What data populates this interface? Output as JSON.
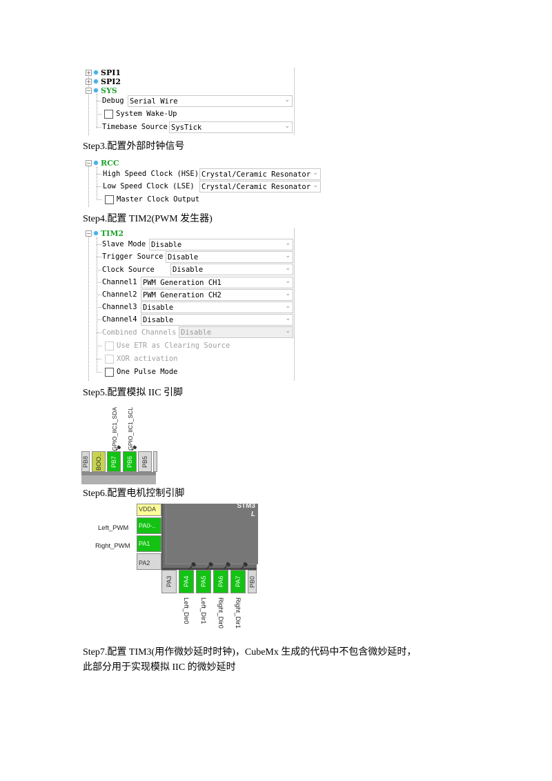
{
  "section_sys": {
    "tree": {
      "nodes": [
        {
          "label": "SPI1",
          "expander": "+",
          "active": false
        },
        {
          "label": "SPI2",
          "expander": "+",
          "active": false
        },
        {
          "label": "SYS",
          "expander": "-",
          "active": true
        }
      ],
      "debug_label": "Debug",
      "debug_value": "Serial Wire",
      "wakeup_label": "System Wake-Up",
      "wakeup_checked": false,
      "timebase_label": "Timebase Source",
      "timebase_value": "SysTick"
    }
  },
  "step3": {
    "title": "Step3.配置外部时钟信号",
    "node_label": "RCC",
    "hse_label": "High Speed Clock (HSE)",
    "hse_value": "Crystal/Ceramic Resonator",
    "lse_label": "Low Speed Clock (LSE)",
    "lse_value": "Crystal/Ceramic Resonator",
    "mco_label": "Master Clock Output",
    "mco_checked": false
  },
  "step4": {
    "title": "Step4.配置 TIM2(PWM 发生器)",
    "node_label": "TIM2",
    "rows": [
      {
        "label": "Slave Mode",
        "value": "Disable",
        "disabled": false
      },
      {
        "label": "Trigger Source",
        "value": "Disable",
        "disabled": false
      },
      {
        "label": "Clock Source",
        "value": "Disable",
        "disabled": false
      },
      {
        "label": "Channel1",
        "value": "PWM Generation CH1",
        "disabled": false
      },
      {
        "label": "Channel2",
        "value": "PWM Generation CH2",
        "disabled": false
      },
      {
        "label": "Channel3",
        "value": "Disable",
        "disabled": false
      },
      {
        "label": "Channel4",
        "value": "Disable",
        "disabled": false
      },
      {
        "label": "Combined Channels",
        "value": "Disable",
        "disabled": true
      }
    ],
    "checkboxes": [
      {
        "label": "Use ETR as Clearing Source",
        "disabled": true,
        "checked": false
      },
      {
        "label": "XOR activation",
        "disabled": true,
        "checked": false
      },
      {
        "label": "One Pulse Mode",
        "disabled": false,
        "checked": false
      }
    ]
  },
  "step5": {
    "title": "Step5.配置模拟 IIC 引脚",
    "pins": [
      {
        "name": "PB8",
        "state": "gray"
      },
      {
        "name": "BOO..",
        "state": "olive"
      },
      {
        "name": "PB7",
        "state": "green",
        "signal": "GPIO_IIC1_SDA"
      },
      {
        "name": "PB6",
        "state": "green",
        "signal": "GPIO_IIC1_SCL"
      },
      {
        "name": "PB5",
        "state": "gray"
      }
    ]
  },
  "step6": {
    "title": "Step6.配置电机控制引脚",
    "left_pins": [
      {
        "name": "VDDA",
        "state": "yellow",
        "signal": ""
      },
      {
        "name": "PA0-..",
        "state": "green",
        "signal": "Left_PWM"
      },
      {
        "name": "PA1",
        "state": "green",
        "signal": "Right_PWM"
      },
      {
        "name": "PA2",
        "state": "gray",
        "signal": ""
      }
    ],
    "bottom_pins": [
      {
        "name": "PA3",
        "state": "gray",
        "signal": ""
      },
      {
        "name": "PA4",
        "state": "green",
        "signal": "Left_Dir0"
      },
      {
        "name": "PA5",
        "state": "green",
        "signal": "Left_Dir1"
      },
      {
        "name": "PA6",
        "state": "green",
        "signal": "Right_Dir0"
      },
      {
        "name": "PA7",
        "state": "green",
        "signal": "Right_Dir1"
      },
      {
        "name": "PB0",
        "state": "gray",
        "signal": ""
      }
    ],
    "chip_text": "STM3",
    "chip_subtext": "L"
  },
  "step7": {
    "line1": "Step7.配置 TIM3(用作微妙延时时钟)，CubeMx 生成的代码中不包含微妙延时，",
    "line2": "此部分用于实现模拟 IIC 的微妙延时"
  }
}
